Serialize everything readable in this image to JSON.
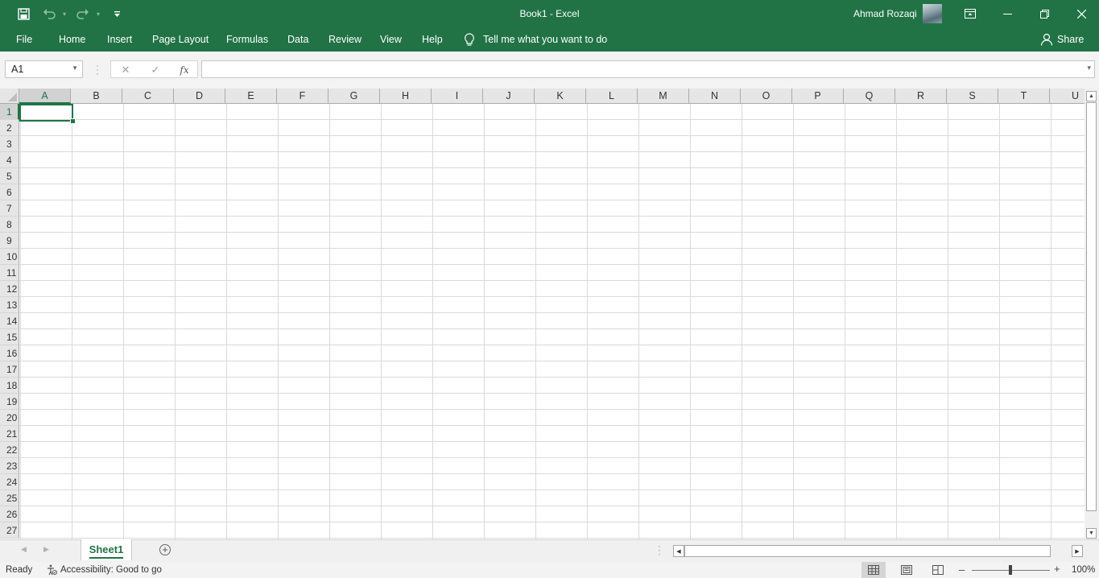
{
  "window": {
    "title": "Book1  -  Excel",
    "user_name": "Ahmad Rozaqi"
  },
  "ribbon": {
    "tabs": [
      "File",
      "Home",
      "Insert",
      "Page Layout",
      "Formulas",
      "Data",
      "Review",
      "View",
      "Help"
    ],
    "tell_me": "Tell me what you want to do",
    "share": "Share"
  },
  "formula_bar": {
    "name_box": "A1",
    "fx_label": "fx",
    "formula": ""
  },
  "sheet": {
    "columns": [
      "A",
      "B",
      "C",
      "D",
      "E",
      "F",
      "G",
      "H",
      "I",
      "J",
      "K",
      "L",
      "M",
      "N",
      "O",
      "P",
      "Q",
      "R",
      "S",
      "T",
      "U"
    ],
    "rows": [
      "1",
      "2",
      "3",
      "4",
      "5",
      "6",
      "7",
      "8",
      "9",
      "10",
      "11",
      "12",
      "13",
      "14",
      "15",
      "16",
      "17",
      "18",
      "19",
      "20",
      "21",
      "22",
      "23",
      "24",
      "25",
      "26",
      "27"
    ],
    "active_cell": "A1",
    "tabs": [
      "Sheet1"
    ],
    "active_tab": "Sheet1"
  },
  "status": {
    "ready": "Ready",
    "accessibility": "Accessibility: Good to go",
    "zoom": "100%"
  },
  "colors": {
    "brand": "#217346",
    "gridline": "#dadada",
    "header_bg": "#e6e6e6"
  },
  "icons": [
    "save-icon",
    "undo-icon",
    "redo-icon",
    "customize-qat-icon",
    "ribbon-display-icon",
    "minimize-icon",
    "restore-icon",
    "close-icon",
    "lightbulb-icon",
    "share-person-icon",
    "cancel-icon",
    "enter-icon",
    "insert-function-icon",
    "add-sheet-icon",
    "accessibility-icon",
    "normal-view-icon",
    "page-layout-view-icon",
    "page-break-preview-icon"
  ]
}
